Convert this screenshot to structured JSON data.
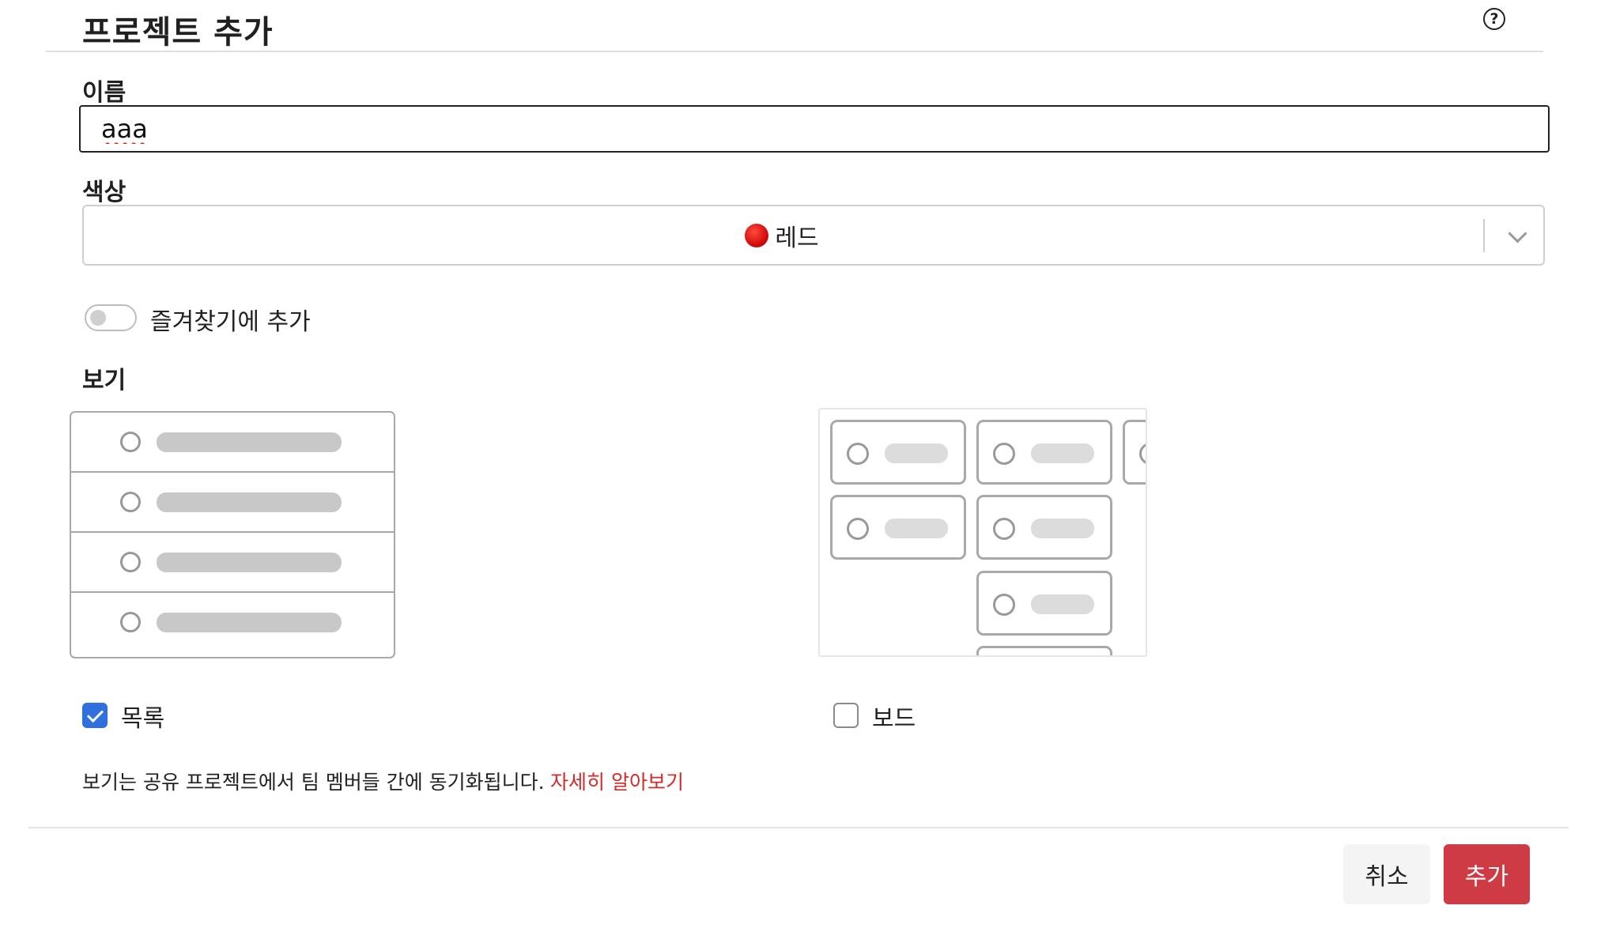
{
  "dialog": {
    "title": "프로젝트 추가",
    "help_icon": "question-circle-icon",
    "help_glyph": "?"
  },
  "name_field": {
    "label": "이름",
    "value": "aaa"
  },
  "color_field": {
    "label": "색상",
    "selected": "레드",
    "selected_color": "#d30e0e",
    "dropdown_icon": "chevron-down-icon"
  },
  "favorite_toggle": {
    "label": "즐겨찾기에 추가",
    "enabled": false
  },
  "view": {
    "label": "보기",
    "options": [
      {
        "label": "목록",
        "checked": true,
        "preview_icon": "list-layout-preview"
      },
      {
        "label": "보드",
        "checked": false,
        "preview_icon": "board-layout-preview"
      }
    ],
    "note": "보기는 공유 프로젝트에서 팀 멤버들 간에 동기화됩니다.",
    "learn_more": "자세히 알아보기"
  },
  "footer": {
    "cancel_label": "취소",
    "submit_label": "추가",
    "accent_color": "#cf3b45"
  }
}
